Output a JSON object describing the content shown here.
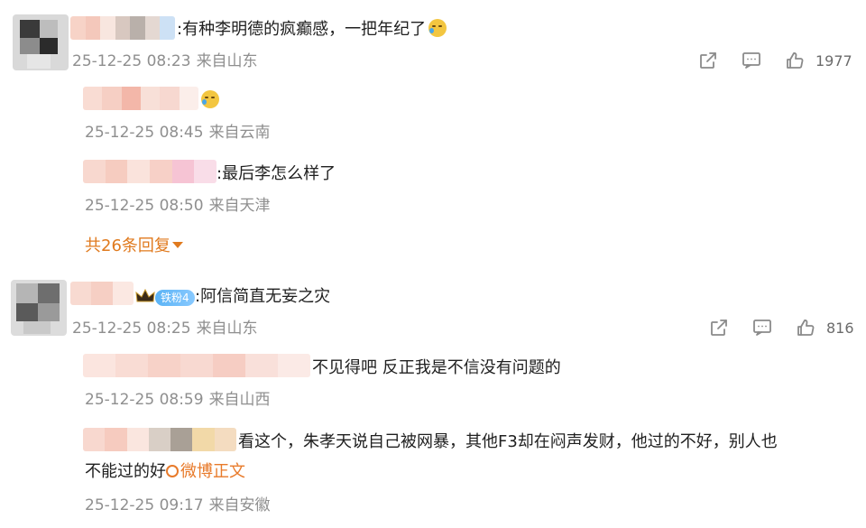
{
  "comments": [
    {
      "text": ":有种李明德的疯癫感，一把年纪了",
      "emoji": "laugh-cry-emoji",
      "time": "25-12-25 08:23",
      "location": "来自山东",
      "likes": "1977",
      "replies": [
        {
          "text": "",
          "emoji": "laugh-cry-emoji",
          "time": "25-12-25 08:45",
          "location": "来自云南"
        },
        {
          "text": ":最后李怎么样了",
          "time": "25-12-25 08:50",
          "location": "来自天津"
        }
      ],
      "more_replies": "共26条回复"
    },
    {
      "text": ":阿信简直无妄之灾",
      "badge": "铁粉4",
      "time": "25-12-25 08:25",
      "location": "来自山东",
      "likes": "816",
      "replies": [
        {
          "text": "不见得吧  反正我是不信没有问题的",
          "time": "25-12-25 08:59",
          "location": "来自山西"
        },
        {
          "text_line1": "看这个，朱孝天说自己被网暴，其他F3却在闷声发财，他过的不好，别人也",
          "text_line2": "不能过的好",
          "link": "微博正文",
          "time": "25-12-25 09:17",
          "location": "来自安徽"
        }
      ]
    }
  ],
  "icons": {
    "share": "share-icon",
    "comment": "comment-icon",
    "like": "thumbs-up-icon"
  },
  "colors": {
    "link": "#e07a1e",
    "meta": "#8f8f8f",
    "badge": "#5ab3f5"
  }
}
